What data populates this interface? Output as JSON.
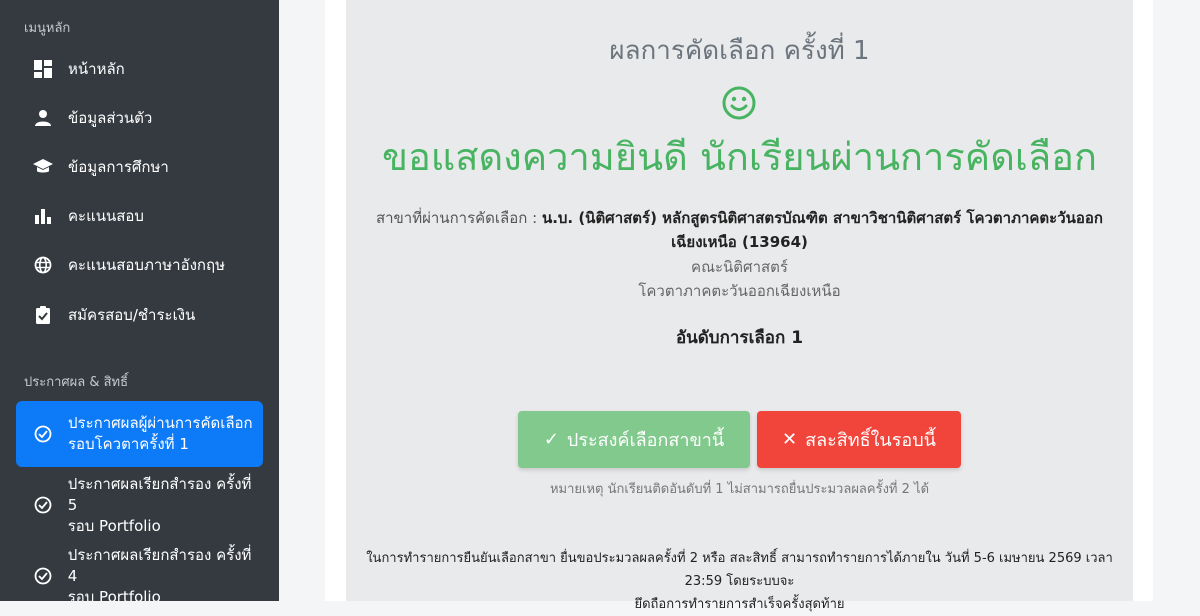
{
  "sidebar": {
    "section_main": "เมนูหลัก",
    "main_items": [
      {
        "label": "หน้าหลัก",
        "icon": "dashboard-icon"
      },
      {
        "label": "ข้อมูลส่วนตัว",
        "icon": "person-icon"
      },
      {
        "label": "ข้อมูลการศึกษา",
        "icon": "graduation-cap-icon"
      },
      {
        "label": "คะแนนสอบ",
        "icon": "bar-chart-icon"
      },
      {
        "label": "คะแนนสอบภาษาอังกฤษ",
        "icon": "globe-icon"
      },
      {
        "label": "สมัครสอบ/ชำระเงิน",
        "icon": "clipboard-check-icon"
      }
    ],
    "section_results": "ประกาศผล & สิทธิ์",
    "result_items": [
      {
        "line1": "ประกาศผลผู้ผ่านการคัดเลือก",
        "line2": "รอบโควตาครั้งที่ 1",
        "icon": "check-circle-icon",
        "active": true
      },
      {
        "line1": "ประกาศผลเรียกสำรอง ครั้งที่ 5",
        "line2": "รอบ Portfolio",
        "icon": "check-circle-icon",
        "active": false
      },
      {
        "line1": "ประกาศผลเรียกสำรอง ครั้งที่ 4",
        "line2": "รอบ Portfolio",
        "icon": "check-circle-icon",
        "active": false
      }
    ]
  },
  "result": {
    "round_title": "ผลการคัดเลือก ครั้งที่ 1",
    "congrats": "ขอแสดงความยินดี นักเรียนผ่านการคัดเลือก",
    "branch_label": "สาขาที่ผ่านการคัดเลือก :",
    "branch_value": "น.บ. (นิติศาสตร์) หลักสูตรนิติศาสตรบัณฑิต สาขาวิชานิติศาสตร์ โควตาภาคตะวันออกเฉียงเหนือ (13964)",
    "faculty": "คณะนิติศาสตร์",
    "quota": "โควตาภาคตะวันออกเฉียงเหนือ",
    "rank": "อันดับการเลือก 1",
    "accept_button": "ประสงค์เลือกสาขานี้",
    "waive_button": "สละสิทธิ์ในรอบนี้",
    "note": "หมายเหตุ นักเรียนติดอันดับที่ 1 ไม่สามารถยื่นประมวลผลครั้งที่ 2 ได้",
    "info_line1": "ในการทำรายการยืนยันเลือกสาขา ยื่นขอประมวลผลครั้งที่ 2 หรือ สละสิทธิ์ สามารถทำรายการได้ภายใน วันที่ 5-6 เมษายน 2569 เวลา 23:59 โดยระบบจะ",
    "info_line2": "ยึดถือการทำรายการสำเร็จครั้งสุดท้าย"
  },
  "colors": {
    "sidebar_bg": "#343a40",
    "active_item": "#0d7bf7",
    "success_green": "#48b461",
    "accept_button": "#82c98d",
    "waive_button": "#f1453c"
  }
}
